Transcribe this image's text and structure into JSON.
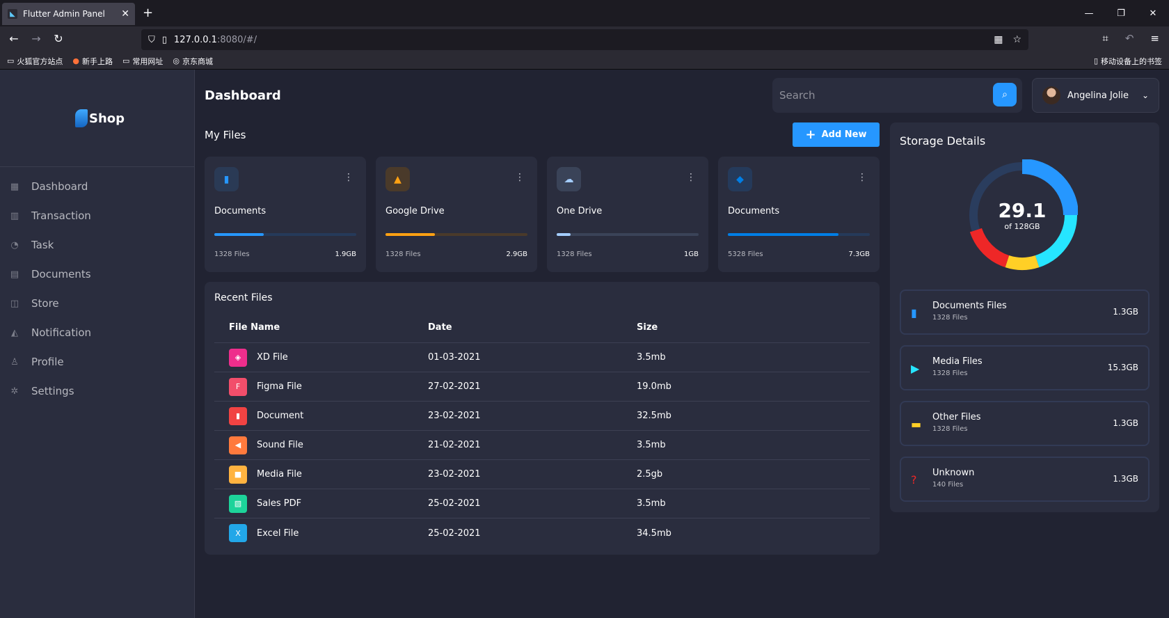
{
  "browser": {
    "tab_title": "Flutter Admin Panel",
    "url_host": "127.0.0.1",
    "url_rest": ":8080/#/",
    "bookmarks": [
      "火狐官方站点",
      "新手上路",
      "常用网址",
      "京东商城"
    ],
    "mobile_bookmarks": "移动设备上的书签"
  },
  "sidebar": {
    "logo_text": "Shop",
    "items": [
      {
        "label": "Dashboard",
        "icon": "grid-icon"
      },
      {
        "label": "Transaction",
        "icon": "chart-icon"
      },
      {
        "label": "Task",
        "icon": "pie-icon"
      },
      {
        "label": "Documents",
        "icon": "document-icon"
      },
      {
        "label": "Store",
        "icon": "bag-icon"
      },
      {
        "label": "Notification",
        "icon": "bell-icon"
      },
      {
        "label": "Profile",
        "icon": "user-icon"
      },
      {
        "label": "Settings",
        "icon": "gear-icon"
      }
    ]
  },
  "header": {
    "title": "Dashboard",
    "search_placeholder": "Search",
    "user_name": "Angelina Jolie"
  },
  "my_files": {
    "title": "My Files",
    "add_new": "Add New",
    "cards": [
      {
        "name": "Documents",
        "files": "1328 Files",
        "size": "1.9GB",
        "percent": 35,
        "color": "#2697ff"
      },
      {
        "name": "Google Drive",
        "files": "1328 Files",
        "size": "2.9GB",
        "percent": 35,
        "color": "#ffa113"
      },
      {
        "name": "One Drive",
        "files": "1328 Files",
        "size": "1GB",
        "percent": 10,
        "color": "#a4cdff"
      },
      {
        "name": "Documents",
        "files": "5328 Files",
        "size": "7.3GB",
        "percent": 78,
        "color": "#007ee5"
      }
    ]
  },
  "recent_files": {
    "title": "Recent Files",
    "columns": [
      "File Name",
      "Date",
      "Size"
    ],
    "rows": [
      {
        "name": "XD File",
        "date": "01-03-2021",
        "size": "3.5mb",
        "color": "#ee2e8c"
      },
      {
        "name": "Figma File",
        "date": "27-02-2021",
        "size": "19.0mb",
        "color": "#f24e6b"
      },
      {
        "name": "Document",
        "date": "23-02-2021",
        "size": "32.5mb",
        "color": "#f14343"
      },
      {
        "name": "Sound File",
        "date": "21-02-2021",
        "size": "3.5mb",
        "color": "#ff7a3d"
      },
      {
        "name": "Media File",
        "date": "23-02-2021",
        "size": "2.5gb",
        "color": "#ffb340"
      },
      {
        "name": "Sales PDF",
        "date": "25-02-2021",
        "size": "3.5mb",
        "color": "#1dd39a"
      },
      {
        "name": "Excel File",
        "date": "25-02-2021",
        "size": "34.5mb",
        "color": "#22a7e8"
      }
    ]
  },
  "storage": {
    "title": "Storage Details",
    "used": "29.1",
    "total": "of 128GB",
    "segments": [
      {
        "color": "#2697ff",
        "value": 25
      },
      {
        "color": "#26e5ff",
        "value": 20
      },
      {
        "color": "#ffcf26",
        "value": 10
      },
      {
        "color": "#ee2727",
        "value": 15
      },
      {
        "color": "#2a3d5e",
        "value": 30
      }
    ],
    "items": [
      {
        "title": "Documents Files",
        "files": "1328 Files",
        "size": "1.3GB",
        "color": "#2697ff",
        "icon": "document-icon"
      },
      {
        "title": "Media Files",
        "files": "1328 Files",
        "size": "15.3GB",
        "color": "#26e5ff",
        "icon": "media-icon"
      },
      {
        "title": "Other Files",
        "files": "1328 Files",
        "size": "1.3GB",
        "color": "#ffcf26",
        "icon": "folder-icon"
      },
      {
        "title": "Unknown",
        "files": "140 Files",
        "size": "1.3GB",
        "color": "#ee2727",
        "icon": "unknown-file-icon"
      }
    ]
  }
}
